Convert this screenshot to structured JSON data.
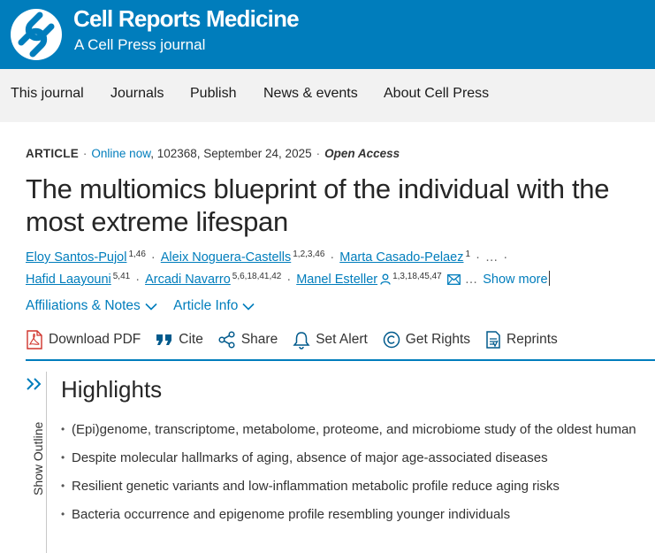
{
  "brand": {
    "title": "Cell Reports Medicine",
    "subtitle": "A Cell Press journal",
    "logo_icon": "cell-press-logo-icon",
    "header_color": "#007dbc"
  },
  "nav": {
    "items": [
      {
        "label": "This journal"
      },
      {
        "label": "Journals"
      },
      {
        "label": "Publish"
      },
      {
        "label": "News & events"
      },
      {
        "label": "About Cell Press"
      }
    ]
  },
  "article": {
    "type": "ARTICLE",
    "online": "Online now",
    "details": ", 102368, September 24, 2025",
    "access": "Open Access",
    "title": "The multiomics blueprint of the individual with the most extreme lifespan",
    "authors_line1": [
      {
        "name": "Eloy Santos-Pujol",
        "aff": "1,46"
      },
      {
        "name": "Aleix Noguera-Castells",
        "aff": "1,2,3,46"
      },
      {
        "name": "Marta Casado-Pelaez",
        "aff": "1"
      }
    ],
    "authors_line2": [
      {
        "name": "Hafid Laayouni",
        "aff": "5,41"
      },
      {
        "name": "Arcadi Navarro",
        "aff": "5,6,18,41,42"
      },
      {
        "name": "Manel Esteller",
        "aff": "1,3,18,45,47"
      }
    ],
    "ellipsis": "…",
    "show_more": "Show more",
    "affiliations_toggle": "Affiliations & Notes",
    "info_toggle": "Article Info"
  },
  "tools": [
    {
      "label": "Download PDF",
      "icon": "pdf-icon"
    },
    {
      "label": "Cite",
      "icon": "quote-icon"
    },
    {
      "label": "Share",
      "icon": "share-icon"
    },
    {
      "label": "Set Alert",
      "icon": "bell-icon"
    },
    {
      "label": "Get Rights",
      "icon": "copyright-icon"
    },
    {
      "label": "Reprints",
      "icon": "reprints-icon"
    }
  ],
  "outline": {
    "label": "Show Outline",
    "icon": "double-chevron-right-icon"
  },
  "highlights": {
    "title": "Highlights",
    "items": [
      "(Epi)genome, transcriptome, metabolome, proteome, and microbiome study of the oldest human",
      "Despite molecular hallmarks of aging, absence of major age-associated diseases",
      "Resilient genetic variants and low-inflammation metabolic profile reduce aging risks",
      "Bacteria occurrence and epigenome profile resembling younger individuals"
    ]
  },
  "colors": {
    "accent": "#007dbc",
    "nav_background": "#f2f2f2",
    "pdf_red": "#d0342c"
  }
}
